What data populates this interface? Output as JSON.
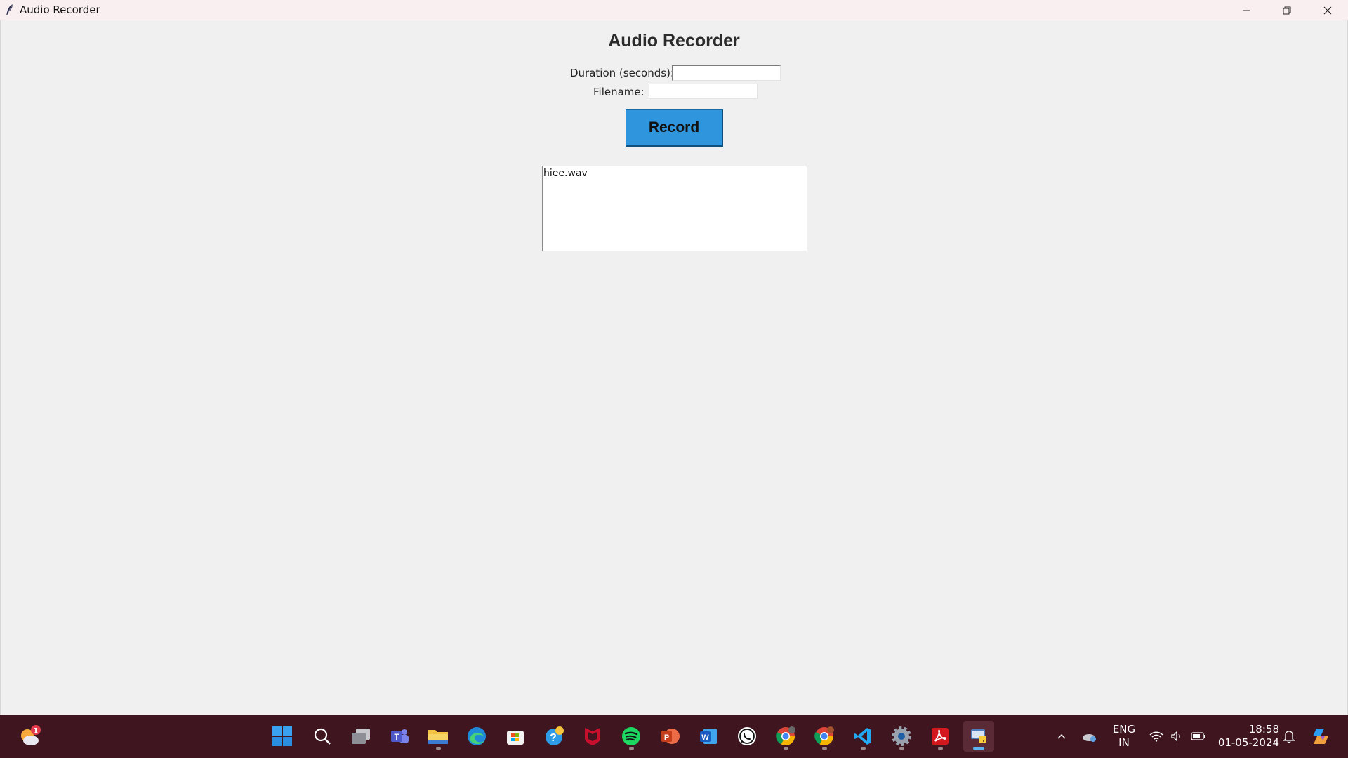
{
  "window": {
    "title": "Audio Recorder"
  },
  "app": {
    "heading": "Audio Recorder",
    "duration_label": "Duration (seconds):",
    "duration_value": "",
    "filename_label": "Filename:",
    "filename_value": "",
    "record_label": "Record",
    "output_text": "hiee.wav"
  },
  "taskbar": {
    "weather_badge": "1",
    "apps": [
      "start",
      "search",
      "task-view",
      "teams",
      "file-explorer",
      "edge",
      "microsoft-store",
      "get-help",
      "mcafee",
      "spotify",
      "powerpoint",
      "word",
      "whatsapp",
      "chrome",
      "chrome-profile",
      "vs-code",
      "settings",
      "acrobat",
      "python"
    ],
    "language": "ENG",
    "region": "IN",
    "time": "18:58",
    "date": "01-05-2024"
  },
  "colors": {
    "record_button": "#2f96de",
    "taskbar": "#3f1520",
    "titlebar": "#f9eef0"
  }
}
